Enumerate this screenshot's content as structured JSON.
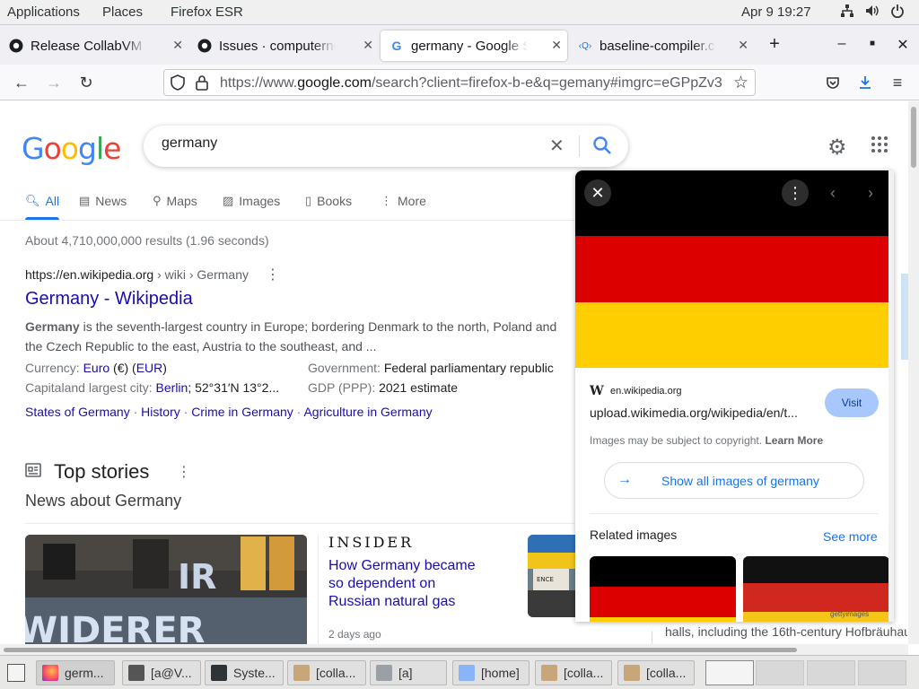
{
  "topbar": {
    "applications": "Applications",
    "places": "Places",
    "app": "Firefox ESR",
    "clock": "Apr 9  19:27"
  },
  "tabs": [
    {
      "label": "Release CollabVM Serv",
      "icon": "github-icon"
    },
    {
      "label": "Issues · computernewb",
      "icon": "github-icon"
    },
    {
      "label": "germany - Google Sear",
      "icon": "google-icon"
    },
    {
      "label": "baseline-compiler.cc - (",
      "icon": "code-search-icon"
    }
  ],
  "navbar": {
    "url_prefix": "https://www.",
    "url_domain": "google.com",
    "url_rest": "/search?client=firefox-b-e&q=gemany#imgrc=eGPpZv3"
  },
  "search": {
    "query": "germany"
  },
  "navtabs": {
    "all": "All",
    "news": "News",
    "maps": "Maps",
    "images": "Images",
    "books": "Books",
    "more": "More"
  },
  "results": {
    "stats": "About 4,710,000,000 results (1.96 seconds)",
    "wiki": {
      "breadcrumb_site": "https://en.wikipedia.org",
      "breadcrumb_path": " › wiki › Germany",
      "title": "Germany - Wikipedia",
      "snippet_bold": "Germany",
      "snippet_rest1": " is the seventh-largest country in Europe; bordering Denmark to the north, Poland and",
      "snippet_line2": "the Czech Republic to the east, Austria to the southeast, and ...",
      "currency_label": "Currency: ",
      "currency_euro": "Euro",
      "currency_sym": " (€) (",
      "currency_eur": "EUR",
      "currency_end": ")",
      "capital_label": "Capitaland largest city: ",
      "capital_link": "Berlin",
      "capital_coords": "; 52°31′N 13°2...",
      "gov_label": "Government: ",
      "gov_value": "Federal parliamentary republic",
      "gdp_label": "GDP (PPP): ",
      "gdp_value": "2021 estimate",
      "links": [
        "States of Germany",
        "History",
        "Crime in Germany",
        "Agriculture in Germany"
      ],
      "sep": " · "
    },
    "top_stories": {
      "heading": "Top stories",
      "subheading": "News about Germany",
      "publisher": "INSIDER",
      "headline_1": "How Germany became",
      "headline_2": "so dependent on",
      "headline_3": "Russian natural gas",
      "time": "2 days ago"
    },
    "right_snippet": "halls, including the 16th-century Hofbräuhau"
  },
  "panel": {
    "source_site": "en.wikipedia.org",
    "source_url": "upload.wikimedia.org/wikipedia/en/t...",
    "visit": "Visit",
    "copyright": "Images may be subject to copyright. ",
    "learn_more": "Learn More",
    "show_all": "Show all images of germany",
    "related": "Related images",
    "see_more": "See more",
    "thumb_watermark": "gettyimages"
  },
  "taskbar": [
    {
      "label": "germ...",
      "icon": "firefox-icon",
      "active": true
    },
    {
      "label": "[a@V...",
      "icon": "terminal-icon"
    },
    {
      "label": "Syste...",
      "icon": "system-monitor-icon"
    },
    {
      "label": "[colla...",
      "icon": "package-icon"
    },
    {
      "label": "[a]",
      "icon": "network-icon"
    },
    {
      "label": "[home]",
      "icon": "file-manager-icon"
    },
    {
      "label": "[colla...",
      "icon": "package-icon"
    },
    {
      "label": "[colla...",
      "icon": "package-icon"
    }
  ],
  "colors": {
    "link": "#1a0dab",
    "accent": "#1a73e8",
    "flag_black": "#000000",
    "flag_red": "#dd0000",
    "flag_gold": "#ffce00"
  }
}
